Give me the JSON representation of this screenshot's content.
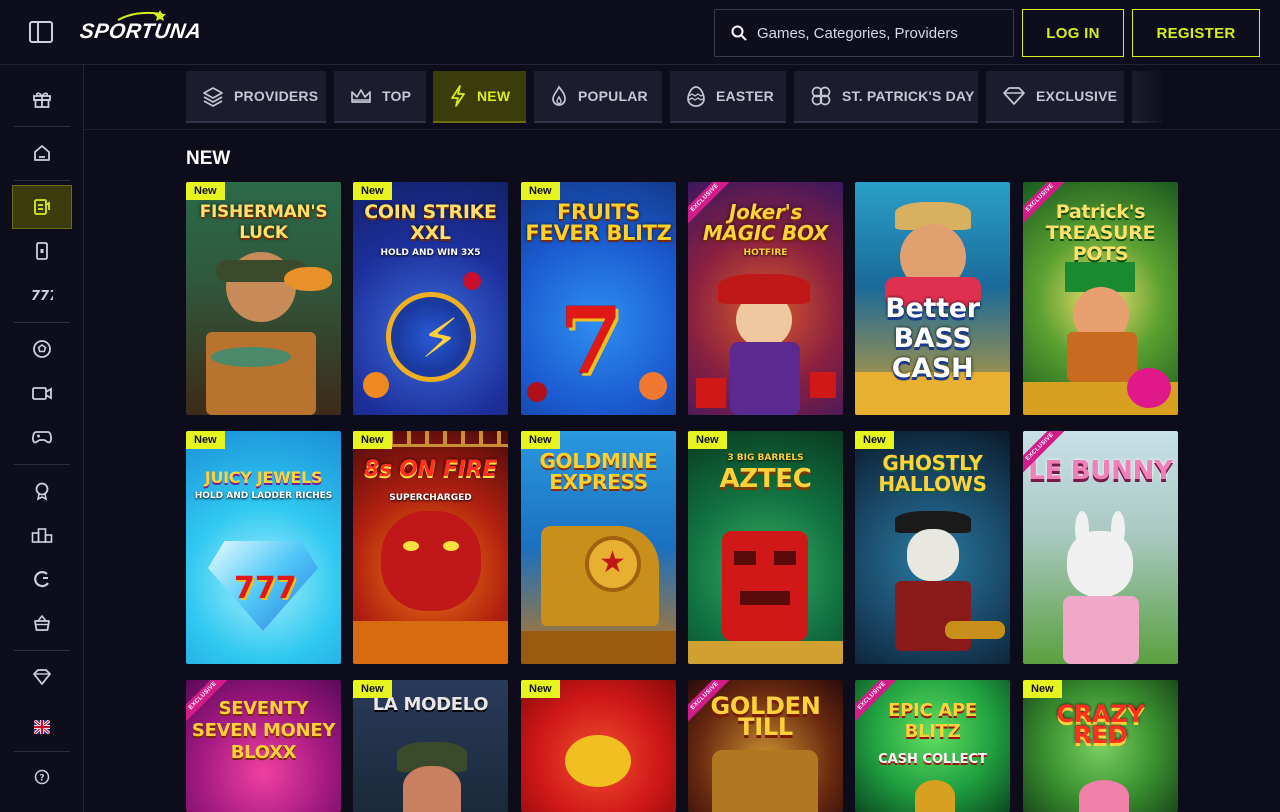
{
  "header": {
    "logo_text": "SPORTUNA",
    "search_placeholder": "Games, Categories, Providers",
    "login_label": "LOG IN",
    "register_label": "REGISTER"
  },
  "sidebar": {
    "items": [
      {
        "icon": "gift-icon"
      },
      {
        "icon": "home-icon"
      },
      {
        "icon": "casino-icon",
        "active": true
      },
      {
        "icon": "live-casino-icon"
      },
      {
        "icon": "slots-777-icon"
      },
      {
        "icon": "sports-ball-icon"
      },
      {
        "icon": "live-video-icon"
      },
      {
        "icon": "gamepad-icon"
      },
      {
        "icon": "award-icon"
      },
      {
        "icon": "podium-icon"
      },
      {
        "icon": "c-logo-icon"
      },
      {
        "icon": "shop-basket-icon"
      },
      {
        "icon": "diamond-icon"
      },
      {
        "icon": "uk-flag-icon"
      },
      {
        "icon": "help-icon"
      }
    ]
  },
  "categories": [
    {
      "label": "PROVIDERS",
      "icon": "layers-icon"
    },
    {
      "label": "TOP",
      "icon": "crown-icon"
    },
    {
      "label": "NEW",
      "icon": "lightning-icon",
      "active": true
    },
    {
      "label": "POPULAR",
      "icon": "flame-icon"
    },
    {
      "label": "EASTER",
      "icon": "easter-egg-icon"
    },
    {
      "label": "ST. PATRICK'S DAY",
      "icon": "clover-icon"
    },
    {
      "label": "EXCLUSIVE",
      "icon": "diamond-icon"
    }
  ],
  "section_title": "NEW",
  "badge_new_label": "New",
  "badge_exclusive_label": "EXCLUSIVE",
  "games": [
    {
      "title": "FISHERMAN'S LUCK",
      "badge": "new"
    },
    {
      "title": "COIN STRIKE XXL",
      "subtitle": "HOLD AND WIN 3X5",
      "badge": "new"
    },
    {
      "title": "FRUITS FEVER BLITZ",
      "badge": "new"
    },
    {
      "title": "Joker's MAGIC BOX",
      "subtitle": "HOTFIRE",
      "badge": "exclusive"
    },
    {
      "title": "Better BASS CASH",
      "badge": "none"
    },
    {
      "title": "Patrick's TREASURE POTS",
      "badge": "exclusive"
    },
    {
      "title": "JUICY JEWELS",
      "subtitle": "HOLD AND LADDER RICHES",
      "badge": "new"
    },
    {
      "title": "8s ON FIRE",
      "subtitle": "SUPERCHARGED",
      "badge": "new"
    },
    {
      "title": "GOLDMINE EXPRESS",
      "badge": "new"
    },
    {
      "title": "AZTEC",
      "subtitle": "3 BIG BARRELS",
      "badge": "new"
    },
    {
      "title": "GHOSTLY HALLOWS",
      "badge": "new"
    },
    {
      "title": "LE BUNNY",
      "badge": "exclusive"
    },
    {
      "title": "SEVENTY SEVEN MONEY BLOXX",
      "badge": "exclusive"
    },
    {
      "title": "LA MODELO",
      "badge": "new"
    },
    {
      "title": "",
      "badge": "new"
    },
    {
      "title": "GOLDEN TILL",
      "badge": "exclusive"
    },
    {
      "title": "EPIC APE BLITZ",
      "subtitle": "CASH COLLECT",
      "badge": "exclusive"
    },
    {
      "title": "CRAZY RED",
      "badge": "new"
    }
  ],
  "colors": {
    "accent": "#d8ee1c",
    "background": "#0c0c1a",
    "active_bg": "#3a3c0c",
    "exclusive": "#d21c8a"
  }
}
